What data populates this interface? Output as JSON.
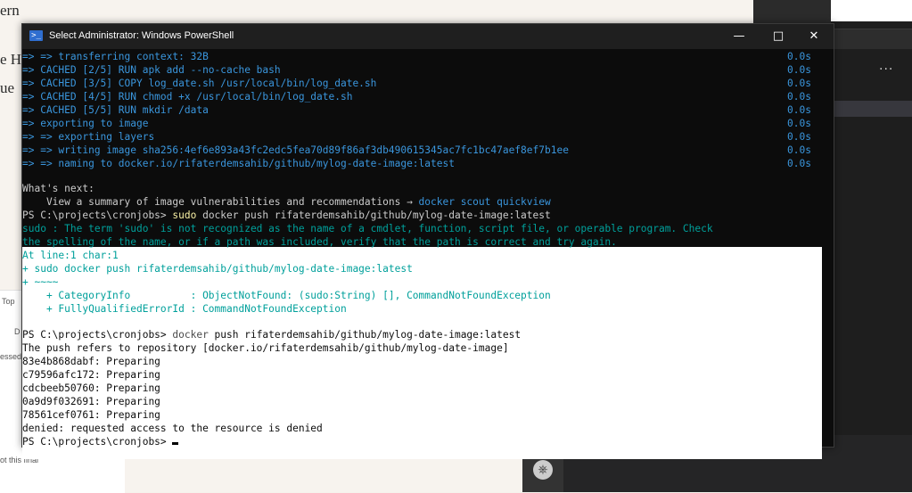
{
  "window": {
    "title": "Select Administrator: Windows PowerShell",
    "minimize_glyph": "—",
    "maximize_glyph": "□",
    "close_glyph": "✕"
  },
  "background": {
    "doc_line1": "ern",
    "doc_line2": "e H",
    "doc_line3": "ue",
    "left_panel_tab": "Top",
    "left_panel_d": "D",
    "left_panel_passed": "essed",
    "left_panel_final": "ot this final",
    "vscode_more": "..."
  },
  "build_output": [
    {
      "text": "=> => transferring context: 32B",
      "time": "0.0s"
    },
    {
      "text": "=> CACHED [2/5] RUN apk add --no-cache bash",
      "time": "0.0s"
    },
    {
      "text": "=> CACHED [3/5] COPY log_date.sh /usr/local/bin/log_date.sh",
      "time": "0.0s"
    },
    {
      "text": "=> CACHED [4/5] RUN chmod +x /usr/local/bin/log_date.sh",
      "time": "0.0s"
    },
    {
      "text": "=> CACHED [5/5] RUN mkdir /data",
      "time": "0.0s"
    },
    {
      "text": "=> exporting to image",
      "time": "0.0s"
    },
    {
      "text": "=> => exporting layers",
      "time": "0.0s"
    },
    {
      "text": "=> => writing image sha256:4ef6e893a43fc2edc5fea70d89f86af3db490615345ac7fc1bc47aef8ef7b1ee",
      "time": "0.0s"
    },
    {
      "text": "=> => naming to docker.io/rifaterdemsahib/github/mylog-date-image:latest",
      "time": "0.0s"
    }
  ],
  "whats_next": {
    "heading": "What's next:",
    "summary_prefix": "    View a summary of image vulnerabilities and recommendations → ",
    "summary_cmd": "docker scout quickview"
  },
  "prompt1": {
    "prompt": "PS C:\\projects\\cronjobs> ",
    "cmd": "sudo",
    "args": " docker push rifaterdemsahib/github/mylog-date-image:latest"
  },
  "error": {
    "line1": "sudo : The term 'sudo' is not recognized as the name of a cmdlet, function, script file, or operable program. Check",
    "line2": "the spelling of the name, or if a path was included, verify that the path is correct and try again.",
    "line3": "At line:1 char:1",
    "line4": "+ sudo docker push rifaterdemsahib/github/mylog-date-image:latest",
    "line5": "+ ~~~~",
    "line6": "    + CategoryInfo          : ObjectNotFound: (sudo:String) [], CommandNotFoundException",
    "line7": "    + FullyQualifiedErrorId : CommandNotFoundException"
  },
  "prompt2": {
    "prompt": "PS C:\\projects\\cronjobs> ",
    "cmd": "docker",
    "args": " push rifaterdemsahib/github/mylog-date-image:latest"
  },
  "push_output": [
    "The push refers to repository [docker.io/rifaterdemsahib/github/mylog-date-image]",
    "83e4b868dabf: Preparing",
    "c79596afc172: Preparing",
    "cdcbeeb50760: Preparing",
    "0a9d9f032691: Preparing",
    "78561cef0761: Preparing",
    "denied: requested access to the resource is denied"
  ],
  "prompt3": {
    "prompt": "PS C:\\projects\\cronjobs> "
  }
}
